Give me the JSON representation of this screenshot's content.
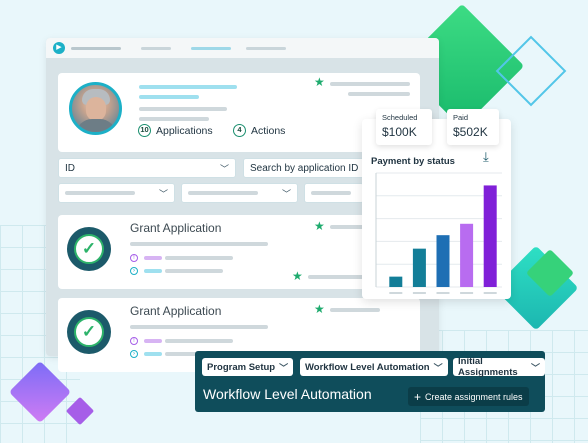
{
  "colors": {
    "background": "#e9f7fb",
    "primary_teal": "#1cb0c7",
    "dark_teal": "#0f4d5b",
    "green": "#1eab6e",
    "bar_teal": "#137e98",
    "bar_blue": "#1e6fb4",
    "bar_purple_light": "#b86cf0",
    "bar_purple": "#8020d8"
  },
  "profile": {
    "applications_count": "10",
    "applications_label": "Applications",
    "actions_count": "4",
    "actions_label": "Actions"
  },
  "filters": {
    "id_label": "ID",
    "search_label": "Search by application ID"
  },
  "grants": [
    {
      "title": "Grant Application"
    },
    {
      "title": "Grant Application"
    }
  ],
  "stats": {
    "scheduled_label": "Scheduled",
    "scheduled_value": "$100K",
    "paid_label": "Paid",
    "paid_value": "$502K"
  },
  "payment_chart": {
    "title": "Payment by status"
  },
  "chart_data": {
    "type": "bar",
    "title": "Payment by status",
    "categories": [
      "",
      "",
      "",
      "",
      ""
    ],
    "values": [
      10,
      37,
      50,
      61,
      98
    ],
    "colors": [
      "#137e98",
      "#137e98",
      "#1e6fb4",
      "#b86cf0",
      "#8020d8"
    ],
    "ylim": [
      0,
      110
    ],
    "grid": true
  },
  "bottom_bar": {
    "dropdowns": [
      "Program Setup",
      "Workflow Level Automation",
      "Initial Assignments"
    ],
    "title": "Workflow Level Automation",
    "create_button": "Create assignment rules"
  },
  "icons": {
    "star": "star-icon",
    "chevron": "chevron-down-icon",
    "download": "download-icon",
    "check": "check-seal-icon",
    "plus": "plus-icon"
  }
}
